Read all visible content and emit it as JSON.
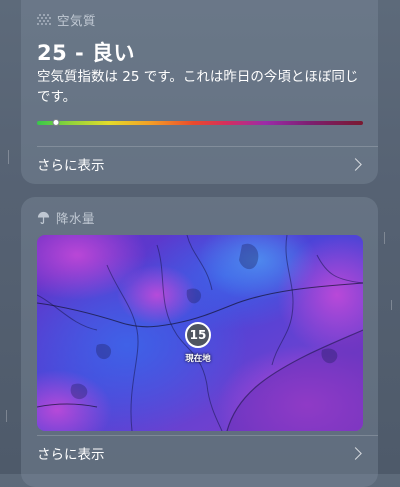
{
  "air_quality": {
    "header_icon": "air-quality-dots-icon",
    "header_label": "空気質",
    "value_text": "25 - 良い",
    "description": "空気質指数は 25 です。これは昨日の今頃とほぼ同じです。",
    "index_value": 25,
    "see_more_label": "さらに表示"
  },
  "precipitation": {
    "header_icon": "umbrella-icon",
    "header_label": "降水量",
    "location_temp": "15",
    "location_label": "現在地",
    "see_more_label": "さらに表示"
  }
}
